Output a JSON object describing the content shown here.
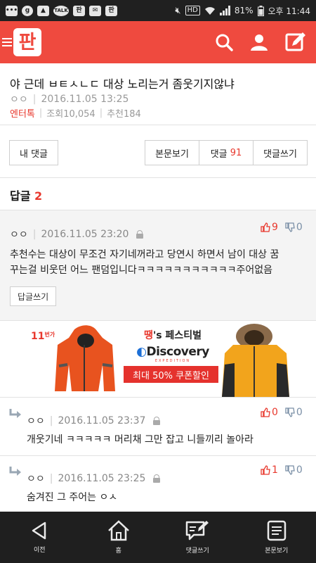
{
  "status_bar": {
    "battery": "81%",
    "time_label": "오후 11:44",
    "icon_names": [
      "message-icon",
      "g-icon",
      "image-icon",
      "talk-icon",
      "pan-icon",
      "mail-icon",
      "pan-icon",
      "mute-icon",
      "hd-icon",
      "wifi-icon",
      "signal-icon",
      "battery-icon"
    ],
    "badges": {
      "talk": "TALK",
      "pan": "판",
      "hd": "HD",
      "g": "g"
    }
  },
  "app_bar": {
    "logo_text": "판",
    "color": "#ef4a3f"
  },
  "post": {
    "title": "야 근데 ㅂㅌㅅㄴㄷ 대상 노리는거 좀웃기지않냐",
    "author": "ㅇㅇ",
    "datetime": "2016.11.05 13:25",
    "category": "엔터톡",
    "views": "조회10,054",
    "recommend": "추천184"
  },
  "buttons": {
    "my_comments": "내 댓글",
    "view_post": "본문보기",
    "comments_label": "댓글",
    "comments_count": "91",
    "write_comment": "댓글쓰기"
  },
  "replies": {
    "label": "답글",
    "count": "2"
  },
  "top_comment": {
    "author": "ㅇㅇ",
    "datetime": "2016.11.05 23:20",
    "upvotes": "9",
    "downvotes": "0",
    "line1": "추천수는 대상이 무조건 자기네꺼라고 당연시 하면서 남이 대상 꿈",
    "line2": "꾸는걸 비웃던 어느 팬덤입니다ㅋㅋㅋㅋㅋㅋㅋㅋㅋㅋㅋ주어없음",
    "reply_button": "답글쓰기"
  },
  "ad": {
    "brand_11": "11",
    "brand_11_sub": "번가",
    "fest_t": "땡",
    "fest_s": "'s 페스티벌",
    "discovery": "Discovery",
    "expedition": "EXPEDITION",
    "sale": "최대 50% 쿠폰할인"
  },
  "sub_comments": [
    {
      "author": "ㅇㅇ",
      "datetime": "2016.11.05 23:37",
      "upvotes": "0",
      "downvotes": "0",
      "text": "개웃기네 ㅋㅋㅋㅋㅋ 머리채 그만 잡고 니들끼리 놀아라"
    },
    {
      "author": "ㅇㅇ",
      "datetime": "2016.11.05 23:25",
      "upvotes": "1",
      "downvotes": "0",
      "text": "숨겨진 그 주어는 ㅇㅅ"
    }
  ],
  "bottom_nav": {
    "back": "이전",
    "home": "홈",
    "write_comment": "댓글쓰기",
    "view_post": "본문보기"
  }
}
